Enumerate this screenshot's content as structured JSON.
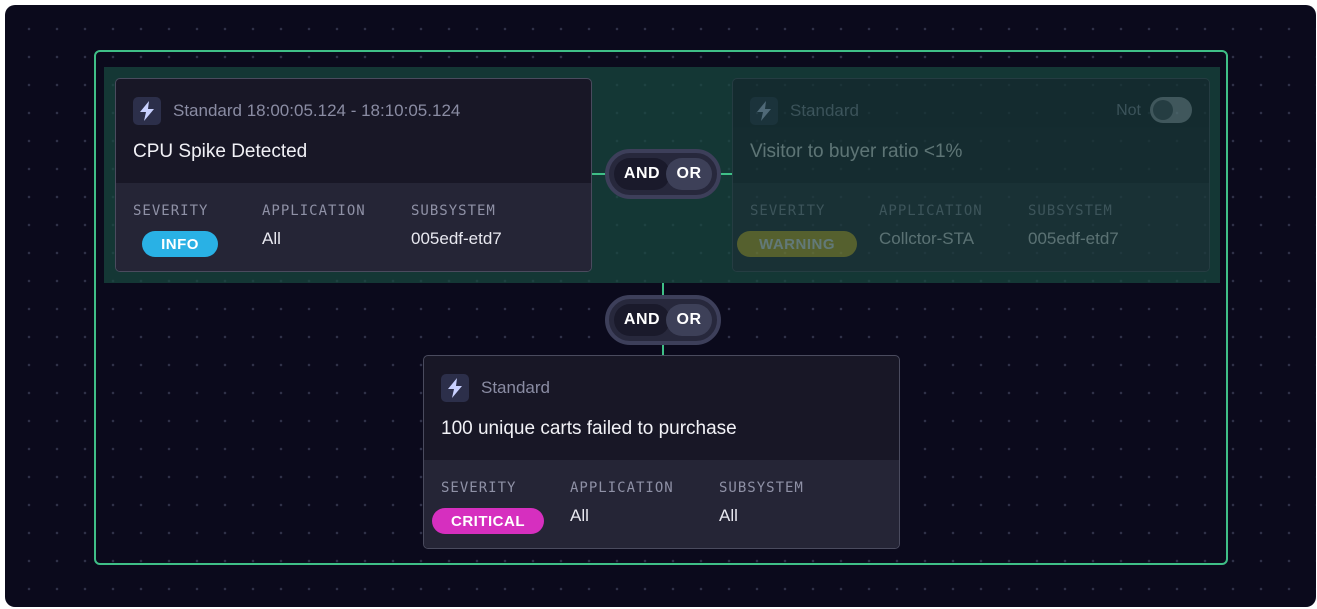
{
  "cards": [
    {
      "kind": "Standard 18:00:05.124 - 18:10:05.124",
      "title": "CPU Spike Detected",
      "severity_label": "SEVERITY",
      "severity": "INFO",
      "severity_color": "#29b1e5",
      "application_label": "APPLICATION",
      "application": "All",
      "subsystem_label": "SUBSYSTEM",
      "subsystem": "005edf-etd7"
    },
    {
      "kind": "Standard",
      "title": "Visitor to buyer ratio <1%",
      "not_label": "Not",
      "not_toggle_on": false,
      "severity_label": "SEVERITY",
      "severity": "WARNING",
      "severity_color": "#d8b321",
      "application_label": "APPLICATION",
      "application": "Collctor-STA",
      "subsystem_label": "SUBSYSTEM",
      "subsystem": "005edf-etd7"
    },
    {
      "kind": "Standard",
      "title": "100 unique carts failed to purchase",
      "severity_label": "SEVERITY",
      "severity": "CRITICAL",
      "severity_color": "#d62fbf",
      "application_label": "APPLICATION",
      "application": "All",
      "subsystem_label": "SUBSYSTEM",
      "subsystem": "All"
    }
  ],
  "operators": [
    {
      "and_label": "AND",
      "or_label": "OR",
      "selected": "AND"
    },
    {
      "and_label": "AND",
      "or_label": "OR",
      "selected": "AND"
    }
  ],
  "icons": {
    "card_type": "lightning-bolt-icon"
  },
  "colors": {
    "background": "#0b0a1c",
    "group_border": "#3fbf87",
    "card_bg": "#181726"
  }
}
